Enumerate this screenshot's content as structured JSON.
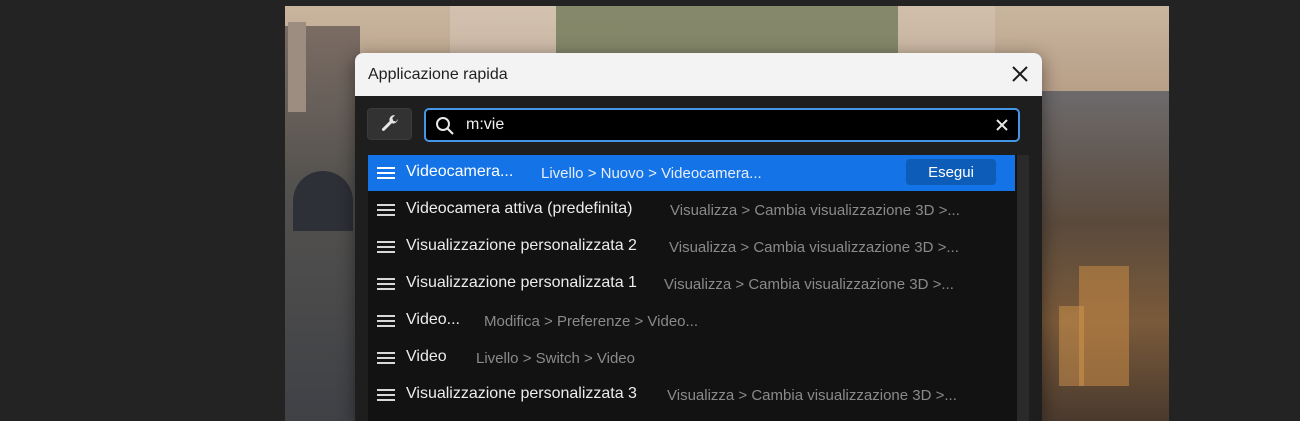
{
  "dialog": {
    "title": "Applicazione rapida",
    "search": {
      "value": "m:vie"
    },
    "run_label": "Esegui",
    "results": [
      {
        "name": "Videocamera...",
        "path": "Livello > Nuovo > Videocamera...",
        "active": true
      },
      {
        "name": "Videocamera attiva (predefinita)",
        "path": "Visualizza > Cambia visualizzazione 3D >..."
      },
      {
        "name": "Visualizzazione personalizzata 2",
        "path": "Visualizza > Cambia visualizzazione 3D >..."
      },
      {
        "name": "Visualizzazione personalizzata 1",
        "path": "Visualizza > Cambia visualizzazione 3D >..."
      },
      {
        "name": "Video...",
        "path": "Modifica > Preferenze > Video..."
      },
      {
        "name": "Video",
        "path": "Livello > Switch > Video"
      },
      {
        "name": "Visualizzazione personalizzata 3",
        "path": "Visualizza > Cambia visualizzazione 3D >..."
      }
    ]
  },
  "icons": {
    "close": "close-icon",
    "wrench": "wrench-icon",
    "search": "search-icon",
    "clear": "clear-icon",
    "menu": "hamburger-icon"
  },
  "colors": {
    "accent": "#1473e6",
    "focus_ring": "#4596e4",
    "titlebar": "#f3f3f3"
  }
}
